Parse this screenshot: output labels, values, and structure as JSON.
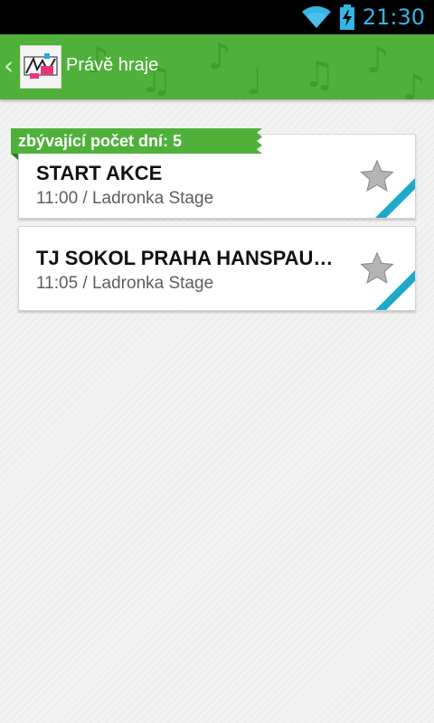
{
  "status_bar": {
    "time": "21:30",
    "icons": [
      "wifi-icon",
      "battery-charging-icon"
    ],
    "accent_color": "#33b5e5"
  },
  "action_bar": {
    "title": "Právě hraje",
    "background_color": "#4fb13a",
    "icons": [
      "back-chevron-icon",
      "app-logo-icon"
    ]
  },
  "ribbon": {
    "label": "zbývající počet dní: 5",
    "color": "#4fb13a"
  },
  "events": [
    {
      "title": "START AKCE",
      "subtitle": "11:00 / Ladronka Stage",
      "favorite": false
    },
    {
      "title": "TJ SOKOL PRAHA HANSPAU…",
      "subtitle": "11:05 / Ladronka Stage",
      "favorite": false
    }
  ],
  "colors": {
    "corner_accent": "#1fa9c9",
    "star": "#aaaaaa"
  }
}
